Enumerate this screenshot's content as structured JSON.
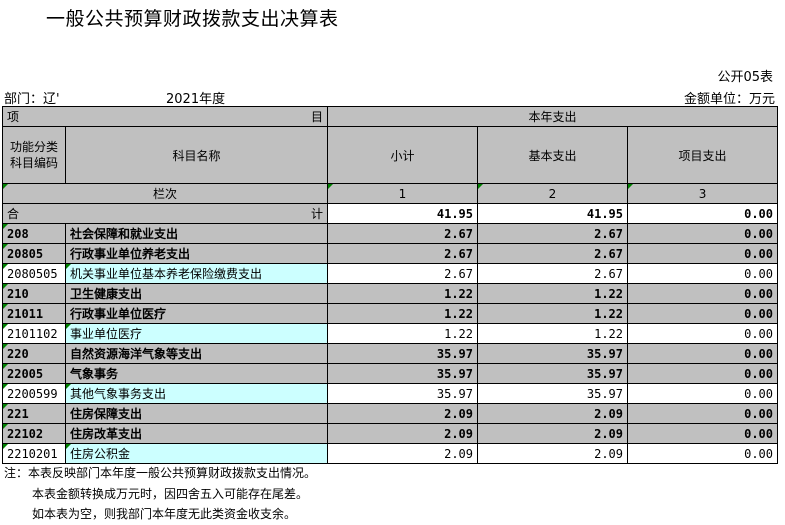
{
  "title": "一般公共预算财政拨款支出决算表",
  "code_label": "公开05表",
  "dept_label": "部门：辽'",
  "year_label": "2021年度",
  "unit_label": "金额单位：万元",
  "header": {
    "xiang": "项",
    "mu": "目",
    "current_year": "本年支出",
    "func_code_line1": "功能分类",
    "func_code_line2": "科目编码",
    "subject_name": "科目名称",
    "subtotal": "小计",
    "basic": "基本支出",
    "project": "项目支出",
    "column_seq": "栏次",
    "col1": "1",
    "col2": "2",
    "col3": "3"
  },
  "total": {
    "he": "合",
    "ji": "计",
    "subtotal": "41.95",
    "basic": "41.95",
    "project": "0.00"
  },
  "rows": [
    {
      "code": "208",
      "name": "社会保障和就业支出",
      "subtotal": "2.67",
      "basic": "2.67",
      "project": "0.00",
      "level": 1
    },
    {
      "code": "20805",
      "name": "行政事业单位养老支出",
      "subtotal": "2.67",
      "basic": "2.67",
      "project": "0.00",
      "level": 2
    },
    {
      "code": "2080505",
      "name": "机关事业单位基本养老保险缴费支出",
      "subtotal": "2.67",
      "basic": "2.67",
      "project": "0.00",
      "level": 3
    },
    {
      "code": "210",
      "name": "卫生健康支出",
      "subtotal": "1.22",
      "basic": "1.22",
      "project": "0.00",
      "level": 1
    },
    {
      "code": "21011",
      "name": "行政事业单位医疗",
      "subtotal": "1.22",
      "basic": "1.22",
      "project": "0.00",
      "level": 2
    },
    {
      "code": "2101102",
      "name": "事业单位医疗",
      "subtotal": "1.22",
      "basic": "1.22",
      "project": "0.00",
      "level": 3
    },
    {
      "code": "220",
      "name": "自然资源海洋气象等支出",
      "subtotal": "35.97",
      "basic": "35.97",
      "project": "0.00",
      "level": 1
    },
    {
      "code": "22005",
      "name": "气象事务",
      "subtotal": "35.97",
      "basic": "35.97",
      "project": "0.00",
      "level": 2
    },
    {
      "code": "2200599",
      "name": "其他气象事务支出",
      "subtotal": "35.97",
      "basic": "35.97",
      "project": "0.00",
      "level": 3
    },
    {
      "code": "221",
      "name": "住房保障支出",
      "subtotal": "2.09",
      "basic": "2.09",
      "project": "0.00",
      "level": 1
    },
    {
      "code": "22102",
      "name": "住房改革支出",
      "subtotal": "2.09",
      "basic": "2.09",
      "project": "0.00",
      "level": 2
    },
    {
      "code": "2210201",
      "name": "住房公积金",
      "subtotal": "2.09",
      "basic": "2.09",
      "project": "0.00",
      "level": 3
    }
  ],
  "notes": [
    "注：本表反映部门本年度一般公共预算财政拨款支出情况。",
    "本表金额转换成万元时，因四舍五入可能存在尾差。",
    "如本表为空，则我部门本年度无此类资金收支余。"
  ]
}
